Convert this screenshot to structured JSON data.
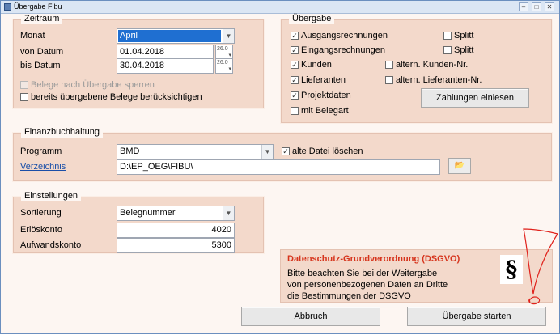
{
  "window": {
    "title": "Übergabe Fibu"
  },
  "zeitraum": {
    "legend": "Zeitraum",
    "monat_label": "Monat",
    "monat_value": "April",
    "von_label": "von Datum",
    "von_value": "01.04.2018",
    "bis_label": "bis Datum",
    "bis_value": "30.04.2018",
    "spin_text": "26.0",
    "sperren_label": "Belege nach Übergabe sperren",
    "sperren_checked": false,
    "sperren_disabled": true,
    "beruecksichtigen_label": "bereits übergebene Belege berücksichtigen",
    "beruecksichtigen_checked": false
  },
  "uebergabe": {
    "legend": "Übergabe",
    "ausgangsrechnungen": {
      "label": "Ausgangsrechnungen",
      "checked": true
    },
    "eingangsrechnungen": {
      "label": "Eingangsrechnungen",
      "checked": true
    },
    "kunden": {
      "label": "Kunden",
      "checked": true
    },
    "lieferanten": {
      "label": "Lieferanten",
      "checked": true
    },
    "projektdaten": {
      "label": "Projektdaten",
      "checked": true
    },
    "mit_belegart": {
      "label": "mit Belegart",
      "checked": false
    },
    "splitt_1": {
      "label": "Splitt",
      "checked": false
    },
    "splitt_2": {
      "label": "Splitt",
      "checked": false
    },
    "altern_kunden": {
      "label": "altern. Kunden-Nr.",
      "checked": false
    },
    "altern_lieferanten": {
      "label": "altern. Lieferanten-Nr.",
      "checked": false
    },
    "zahlungen_button": "Zahlungen einlesen"
  },
  "finanzbuchhaltung": {
    "legend": "Finanzbuchhaltung",
    "programm_label": "Programm",
    "programm_value": "BMD",
    "alte_datei_label": "alte Datei löschen",
    "alte_datei_checked": true,
    "verzeichnis_label": "Verzeichnis",
    "verzeichnis_value": "D:\\EP_OEG\\FIBU\\"
  },
  "einstellungen": {
    "legend": "Einstellungen",
    "sortierung_label": "Sortierung",
    "sortierung_value": "Belegnummer",
    "erloeskonto_label": "Erlöskonto",
    "erloeskonto_value": "4020",
    "aufwandskonto_label": "Aufwandskonto",
    "aufwandskonto_value": "5300"
  },
  "dsgvo": {
    "title": "Datenschutz-Grundverordnung (DSGVO)",
    "line1": "Bitte beachten Sie bei der Weitergabe",
    "line2": "von personenbezogenen Daten an Dritte",
    "line3": "die Bestimmungen der DSGVO",
    "symbol": "§"
  },
  "footer": {
    "abbruch": "Abbruch",
    "uebergabe_starten": "Übergabe starten"
  },
  "colors": {
    "panel_bg": "#f3d9cb",
    "selection": "#1f6fd1",
    "dsgvo_title": "#d6341c",
    "annotation_red": "#e0221c"
  }
}
